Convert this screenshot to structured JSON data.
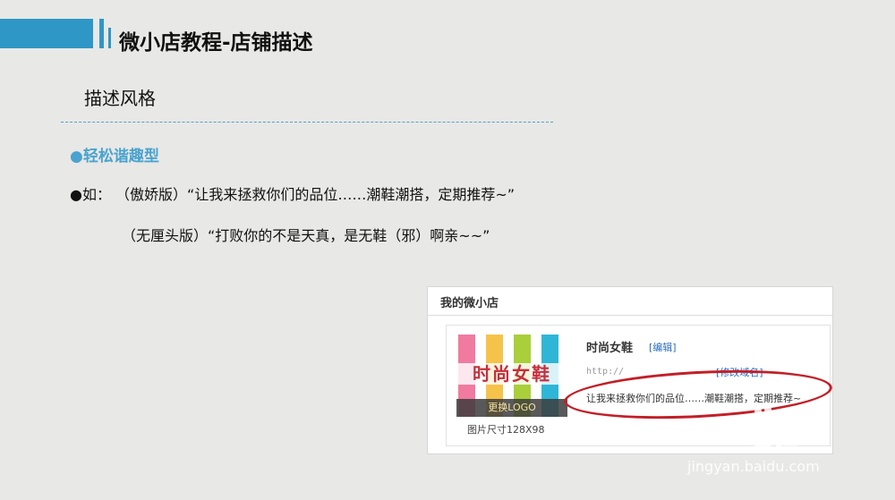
{
  "header": {
    "title": "微小店教程-店铺描述",
    "accent_color": "#2f97c6"
  },
  "section": {
    "title": "描述风格"
  },
  "content": {
    "bullet_heading": "●轻松谐趣型",
    "example_line1": "●如： （傲娇版）“让我来拯救你们的品位……潮鞋潮搭，定期推荐~”",
    "example_line2": "（无厘头版）“打败你的不是天真，是无鞋（邪）啊亲~~”"
  },
  "screenshot": {
    "panel_title": "我的微小店",
    "logo_text": "时尚女鞋",
    "logo_change": "更换LOGO",
    "size_label": "图片尺寸128X98",
    "shop_name": "时尚女鞋",
    "edit_link": "[编辑]",
    "url": "http://",
    "url_link": "[修改域名]",
    "description": "让我来拯救你们的品位……潮鞋潮搭，定期推荐~",
    "stripe_colors": [
      "#f07aa0",
      "#f6c34a",
      "#a9cf3a",
      "#2fb6d6"
    ],
    "highlight_color": "#c21f27"
  },
  "watermark": {
    "brand": "Bai 经验",
    "url": "jingyan.baidu.com",
    "paw_icon": "paw-icon"
  }
}
